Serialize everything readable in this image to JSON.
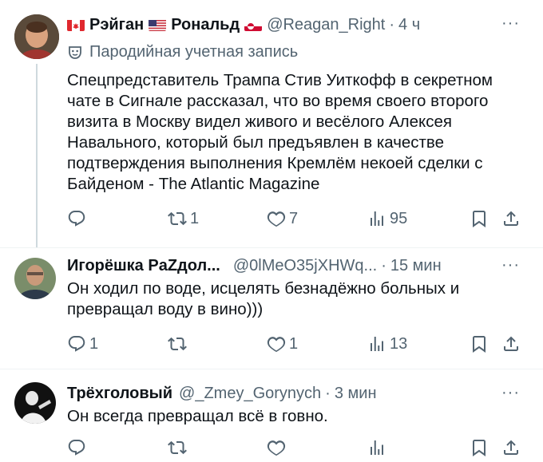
{
  "posts": [
    {
      "display_name_1": "Рэйган",
      "display_name_2": "Рональд",
      "handle": "@Reagan_Right",
      "time": "4 ч",
      "parody_label": "Пародийная учетная запись",
      "text_lines": [
        "Спецпредставитель Трампа Стив Уиткофф в секретном",
        "чате в Сигнале рассказал, что во время своего второго",
        "визита в Москву видел живого и весёлого Алексея",
        "Навального, который был предъявлен в качестве",
        "подтверждения выполнения Кремлём некоей сделки с",
        "Байденом - The Atlantic Magazine"
      ],
      "replies": "",
      "reposts": "1",
      "likes": "7",
      "views": "95"
    },
    {
      "display_name": "Игорёшка PaZдол...",
      "handle": "@0lMeO35jXHWq...",
      "time": "15 мин",
      "text_lines": [
        "Он ходил по воде, исцелять безнадёжно больных и",
        "превращал воду в вино)))"
      ],
      "replies": "1",
      "reposts": "",
      "likes": "1",
      "views": "13"
    },
    {
      "display_name": "Трёхголовый",
      "handle": "@_Zmey_Gorynych",
      "time": "3 мин",
      "text_lines": [
        "Он всегда превращал всё в говно."
      ],
      "replies": "",
      "reposts": "",
      "likes": "",
      "views": ""
    }
  ],
  "more_glyph": "···",
  "dot": "·",
  "colors": {
    "secondary": "#536471",
    "text": "#0f1419",
    "divider": "#eff3f4"
  },
  "icons": [
    "reply-icon",
    "repost-icon",
    "like-icon",
    "views-icon",
    "bookmark-icon",
    "share-icon",
    "more-icon",
    "parody-mask-icon"
  ]
}
